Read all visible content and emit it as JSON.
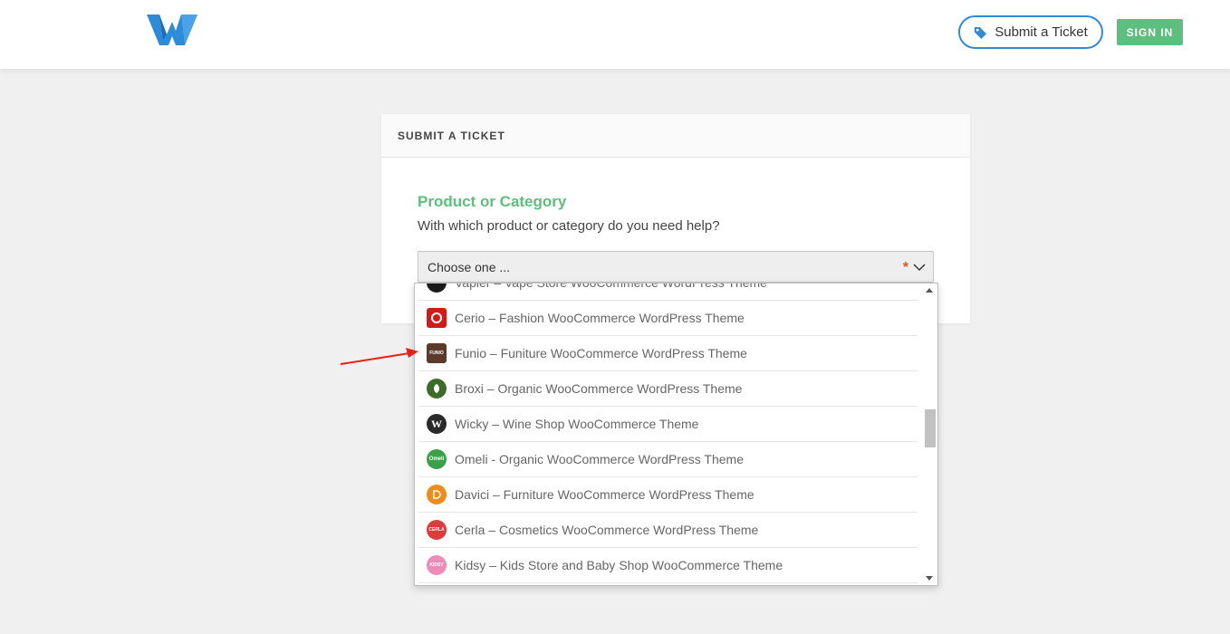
{
  "header": {
    "submit_ticket_label": "Submit a Ticket",
    "sign_in_label": "SIGN IN",
    "brand_color": "#2e8bd7",
    "accent_color": "#5cbf7d"
  },
  "card": {
    "title": "SUBMIT A TICKET",
    "field_title": "Product or Category",
    "field_help": "With which product or category do you need help?",
    "select_value": "Choose one ...",
    "required_mark": "*"
  },
  "dropdown": {
    "options": [
      {
        "label": "Vapier – Vape Store WooCommerce WordPress Theme",
        "icon_color": "#1a1a1a"
      },
      {
        "label": "Cerio – Fashion WooCommerce WordPress Theme",
        "icon_color": "#d11a1a"
      },
      {
        "label": "Funio – Funiture WooCommerce WordPress Theme",
        "icon_color": "#5a3a2a",
        "icon_text": "FUNIO"
      },
      {
        "label": "Broxi – Organic WooCommerce WordPress Theme",
        "icon_color": "#3d6b2a"
      },
      {
        "label": "Wicky – Wine Shop WooCommerce Theme",
        "icon_color": "#2a2a2a",
        "icon_text": "W"
      },
      {
        "label": "Omeli - Organic WooCommerce WordPress Theme",
        "icon_color": "#3aa14a",
        "icon_text": "Omeli"
      },
      {
        "label": "Davici – Furniture WooCommerce WordPress Theme",
        "icon_color": "#f28a1a"
      },
      {
        "label": "Cerla – Cosmetics WooCommerce WordPress Theme",
        "icon_color": "#e03a3a",
        "icon_text": "CERLA"
      },
      {
        "label": "Kidsy – Kids Store and Baby Shop WooCommerce Theme",
        "icon_color": "#f08ab8",
        "icon_text": "KIDSY"
      }
    ]
  },
  "annotation": {
    "arrow_color": "#e8201a"
  }
}
